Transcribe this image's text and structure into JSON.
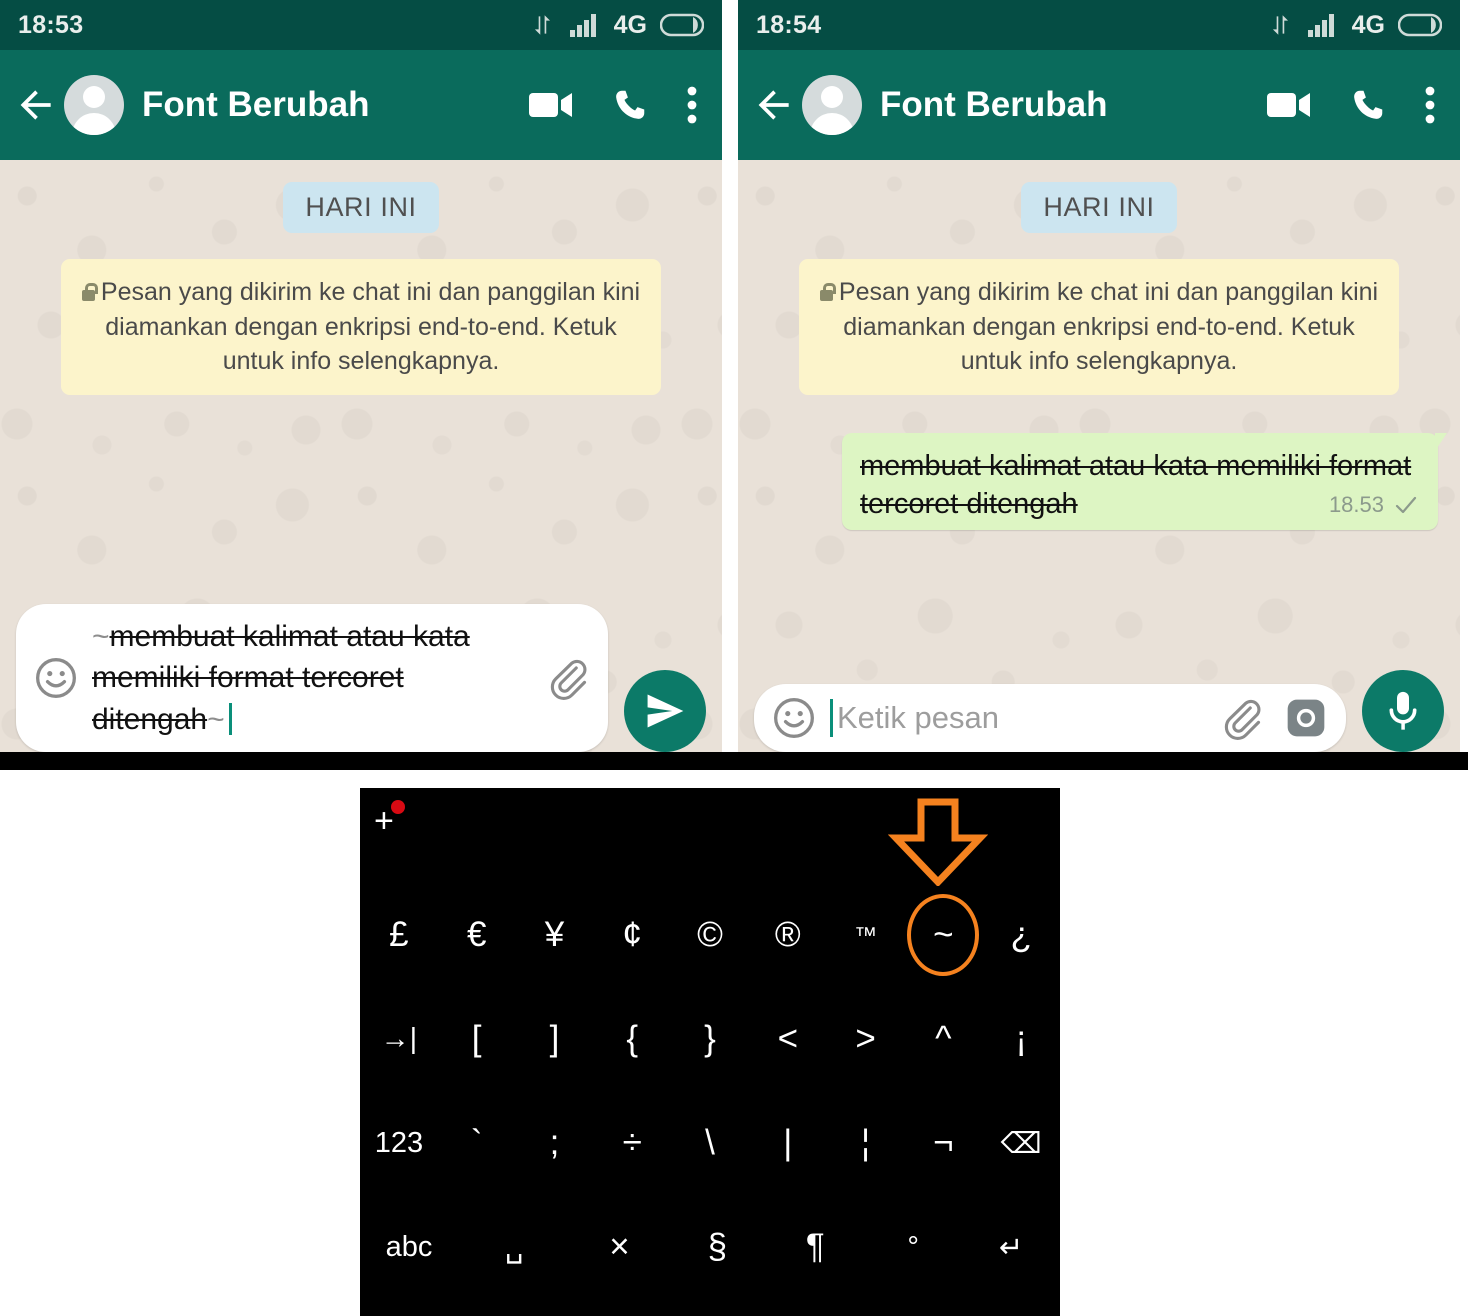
{
  "colors": {
    "statusbar_bg": "#054D44",
    "appbar_bg": "#0A6B5C",
    "chat_bg": "#E9E1D8",
    "outgoing_bubble": "#DDF5C3",
    "day_chip": "#CCE5F0",
    "encryption_note": "#FCF4CB",
    "accent_green": "#0C7A68",
    "highlight_orange": "#F5821F",
    "keyboard_bg": "#000000",
    "badge_red": "#D80A13"
  },
  "panels": [
    {
      "id": "left",
      "statusbar": {
        "time": "18:53",
        "network": "4G",
        "icons": [
          "data-transfer-icon",
          "signal-bars-icon",
          "battery-icon"
        ]
      },
      "appbar": {
        "back_label": "back-arrow",
        "title": "Font Berubah",
        "actions": [
          "video-call-icon",
          "voice-call-icon",
          "overflow-menu-icon"
        ]
      },
      "chat": {
        "day_chip": "HARI INI",
        "encryption_note": "Pesan yang dikirim ke chat ini dan panggilan kini diamankan dengan enkripsi end-to-end. Ketuk untuk info selengkapnya.",
        "messages": []
      },
      "composer": {
        "mode": "typing",
        "typed_prefix_tilde": "~",
        "typed_text": "membuat kalimat atau kata memiliki format tercoret ditengah",
        "typed_suffix_tilde": "~",
        "placeholder": "Ketik pesan",
        "icons": [
          "emoji-icon",
          "attach-icon"
        ],
        "send_button": "send-icon"
      }
    },
    {
      "id": "right",
      "statusbar": {
        "time": "18:54",
        "network": "4G",
        "icons": [
          "data-transfer-icon",
          "signal-bars-icon",
          "battery-icon"
        ]
      },
      "appbar": {
        "back_label": "back-arrow",
        "title": "Font Berubah",
        "actions": [
          "video-call-icon",
          "voice-call-icon",
          "overflow-menu-icon"
        ]
      },
      "chat": {
        "day_chip": "HARI INI",
        "encryption_note": "Pesan yang dikirim ke chat ini dan panggilan kini diamankan dengan enkripsi end-to-end. Ketuk untuk info selengkapnya.",
        "messages": [
          {
            "direction": "outgoing",
            "text": "membuat kalimat atau kata memiliki format tercoret ditengah",
            "format": "strikethrough",
            "time": "18.53",
            "status": "sent-check"
          }
        ]
      },
      "composer": {
        "mode": "empty",
        "placeholder": "Ketik pesan",
        "icons": [
          "emoji-icon",
          "attach-icon",
          "camera-icon"
        ],
        "mic_button": "mic-icon"
      }
    }
  ],
  "keyboard": {
    "plus_label": "+",
    "has_red_badge": true,
    "highlighted_key": "~",
    "annotation": "orange-arrow-pointing-to-tilde-key",
    "rows": [
      [
        {
          "label": "£",
          "name": "key-pound"
        },
        {
          "label": "€",
          "name": "key-euro"
        },
        {
          "label": "¥",
          "name": "key-yen"
        },
        {
          "label": "¢",
          "name": "key-cent"
        },
        {
          "label": "©",
          "name": "key-copyright"
        },
        {
          "label": "®",
          "name": "key-registered"
        },
        {
          "label": "™",
          "name": "key-trademark",
          "size": "tiny"
        },
        {
          "label": "~",
          "name": "key-tilde",
          "highlighted": true
        },
        {
          "label": "¿",
          "name": "key-inverted-question"
        }
      ],
      [
        {
          "label": "→|",
          "name": "key-tab",
          "size": "small"
        },
        {
          "label": "[",
          "name": "key-bracket-left"
        },
        {
          "label": "]",
          "name": "key-bracket-right"
        },
        {
          "label": "{",
          "name": "key-brace-left"
        },
        {
          "label": "}",
          "name": "key-brace-right"
        },
        {
          "label": "<",
          "name": "key-less-than"
        },
        {
          "label": ">",
          "name": "key-greater-than"
        },
        {
          "label": "^",
          "name": "key-caret"
        },
        {
          "label": "¡",
          "name": "key-inverted-exclamation"
        }
      ],
      [
        {
          "label": "123",
          "name": "key-numeric-layout",
          "size": "small"
        },
        {
          "label": "`",
          "name": "key-backtick"
        },
        {
          "label": ";",
          "name": "key-semicolon"
        },
        {
          "label": "÷",
          "name": "key-divide"
        },
        {
          "label": "\\",
          "name": "key-backslash"
        },
        {
          "label": "|",
          "name": "key-pipe"
        },
        {
          "label": "¦",
          "name": "key-broken-bar"
        },
        {
          "label": "¬",
          "name": "key-not-sign"
        },
        {
          "label": "⌫",
          "name": "key-backspace",
          "size": "small"
        }
      ],
      [
        {
          "label": "abc",
          "name": "key-alpha-layout",
          "size": "small"
        },
        {
          "label": "␣",
          "name": "key-space",
          "size": "small",
          "wide": true
        },
        {
          "label": "×",
          "name": "key-multiply"
        },
        {
          "label": "§",
          "name": "key-section"
        },
        {
          "label": "¶",
          "name": "key-pilcrow"
        },
        {
          "label": "°",
          "name": "key-degree",
          "size": "small"
        },
        {
          "label": "↵",
          "name": "key-enter",
          "size": "small"
        }
      ]
    ]
  }
}
